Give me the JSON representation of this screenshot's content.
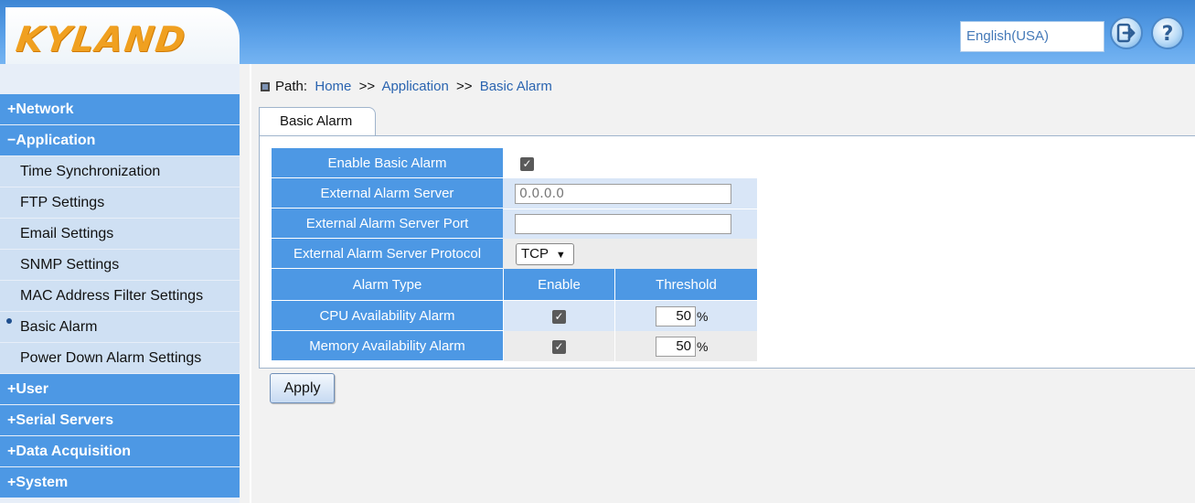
{
  "header": {
    "logo_text": "KYLAND",
    "language": "English(USA)",
    "logout_icon": "logout-icon",
    "help_icon": "help-icon"
  },
  "sidebar": {
    "items": [
      {
        "label": "+Network",
        "type": "main"
      },
      {
        "label": "−Application",
        "type": "main"
      },
      {
        "label": "Time Synchronization",
        "type": "sub"
      },
      {
        "label": "FTP Settings",
        "type": "sub"
      },
      {
        "label": "Email Settings",
        "type": "sub"
      },
      {
        "label": "SNMP Settings",
        "type": "sub"
      },
      {
        "label": "MAC Address Filter Settings",
        "type": "sub"
      },
      {
        "label": "Basic Alarm",
        "type": "sub",
        "active": true
      },
      {
        "label": "Power Down Alarm Settings",
        "type": "sub"
      },
      {
        "label": "+User",
        "type": "main"
      },
      {
        "label": "+Serial Servers",
        "type": "main"
      },
      {
        "label": "+Data Acquisition",
        "type": "main"
      },
      {
        "label": "+System",
        "type": "main"
      }
    ]
  },
  "breadcrumb": {
    "prefix": "Path:",
    "home": "Home",
    "sep1": ">>",
    "section": "Application",
    "sep2": ">>",
    "page": "Basic Alarm"
  },
  "tab": {
    "label": "Basic Alarm"
  },
  "form": {
    "enable_label": "Enable Basic Alarm",
    "enable_checked": true,
    "server_label": "External Alarm Server",
    "server_value": "0.0.0.0",
    "port_label": "External Alarm Server Port",
    "port_value": "",
    "protocol_label": "External Alarm Server Protocol",
    "protocol_value": "TCP",
    "col_alarm_type": "Alarm Type",
    "col_enable": "Enable",
    "col_threshold": "Threshold",
    "cpu_label": "CPU Availability Alarm",
    "cpu_enabled": true,
    "cpu_threshold": "50",
    "mem_label": "Memory Availability Alarm",
    "mem_enabled": true,
    "mem_threshold": "50",
    "percent": "%"
  },
  "actions": {
    "apply_label": "Apply"
  },
  "colors": {
    "header_blue": "#4d98e4",
    "sub_item_bg": "#cfe0f3",
    "link_blue": "#2a64b0",
    "logo_orange": "#f0a020"
  }
}
